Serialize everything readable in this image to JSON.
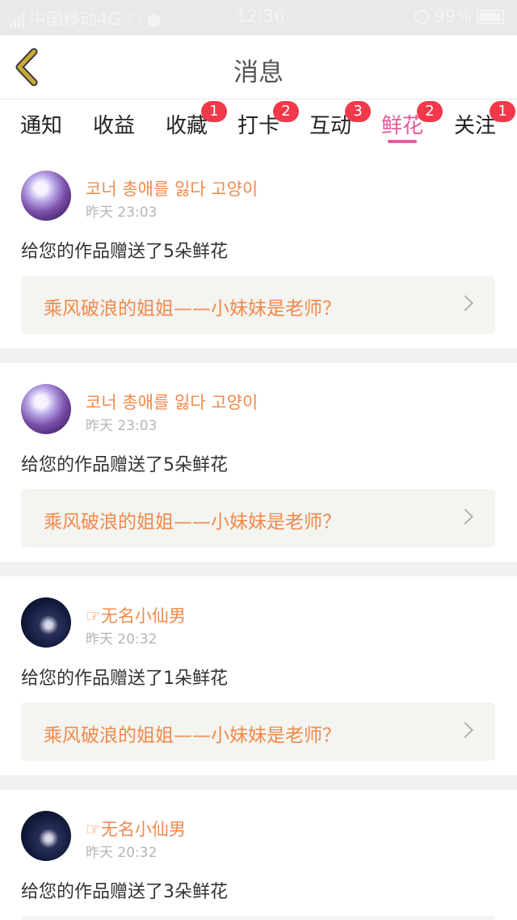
{
  "status_bar": {
    "carrier": "中国移动4G",
    "time": "12:36",
    "battery": "99%",
    "icons": [
      "signal-icon",
      "wifi-icon",
      "message-icon",
      "mute-icon",
      "battery-icon"
    ]
  },
  "header": {
    "title": "消息",
    "back_icon": "chevron-left-icon",
    "back_color": "#c9a93b"
  },
  "tabs": [
    {
      "label": "通知",
      "badge": ""
    },
    {
      "label": "收益",
      "badge": ""
    },
    {
      "label": "收藏",
      "badge": "1"
    },
    {
      "label": "打卡",
      "badge": "2"
    },
    {
      "label": "互动",
      "badge": "3"
    },
    {
      "label": "鲜花",
      "badge": "2",
      "active": true
    },
    {
      "label": "关注",
      "badge": "1"
    }
  ],
  "accent_color": "#e55a9b",
  "name_color": "#f08a4b",
  "badge_color": "#f1394a",
  "items": [
    {
      "user": "코너 총애를 잃다 고양이",
      "time": "昨天 23:03",
      "message": "给您的作品赠送了5朵鲜花",
      "work": "乘风破浪的姐姐——小妹妹是老师？"
    },
    {
      "user": "코너 총애를 잃다 고양이",
      "time": "昨天 23:03",
      "message": "给您的作品赠送了5朵鲜花",
      "work": "乘风破浪的姐姐——小妹妹是老师？"
    },
    {
      "user": "☞无名小仙男",
      "time": "昨天 20:32",
      "message": "给您的作品赠送了1朵鲜花",
      "work": "乘风破浪的姐姐——小妹妹是老师？"
    },
    {
      "user": "☞无名小仙男",
      "time": "昨天 20:32",
      "message": "给您的作品赠送了3朵鲜花",
      "work": ""
    }
  ]
}
